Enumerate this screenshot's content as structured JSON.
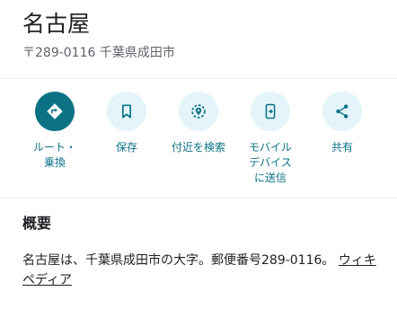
{
  "place": {
    "title": "名古屋",
    "subtitle": "〒289-0116 千葉県成田市"
  },
  "actions": [
    {
      "label": "ルート・乗換",
      "icon": "directions-icon"
    },
    {
      "label": "保存",
      "icon": "bookmark-icon"
    },
    {
      "label": "付近を検索",
      "icon": "nearby-search-icon"
    },
    {
      "label": "モバイルデバイスに送信",
      "icon": "send-to-phone-icon"
    },
    {
      "label": "共有",
      "icon": "share-icon"
    }
  ],
  "overview": {
    "heading": "概要",
    "text": "名古屋は、千葉県成田市の大字。郵便番号289-0116。",
    "link": "ウィキペディア"
  },
  "colors": {
    "accent": "#0b7285",
    "action_bg": "#e3f4fa",
    "divider": "#e8eaed",
    "subtitle": "#5f6368"
  }
}
